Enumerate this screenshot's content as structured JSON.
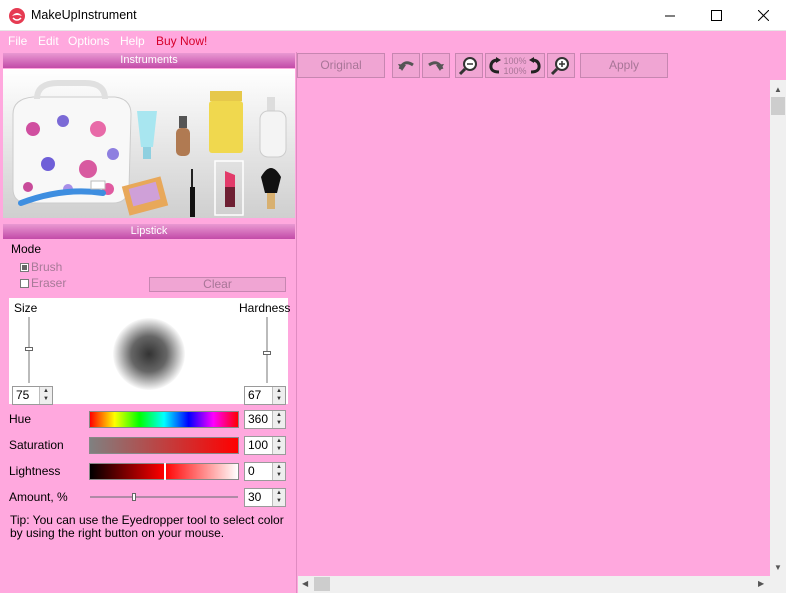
{
  "window": {
    "title": "MakeUpInstrument"
  },
  "menu": {
    "file": "File",
    "edit": "Edit",
    "options": "Options",
    "help": "Help",
    "buy": "Buy Now!"
  },
  "panels": {
    "instruments": "Instruments",
    "tool": "Lipstick"
  },
  "mode": {
    "label": "Mode",
    "brush": "Brush",
    "eraser": "Eraser",
    "clear": "Clear",
    "brush_checked": true
  },
  "brush": {
    "size_label": "Size",
    "hardness_label": "Hardness",
    "size": "75",
    "hardness": "67",
    "size_level": 0.52,
    "hardness_level": 0.45
  },
  "color": {
    "hue_label": "Hue",
    "hue": "360",
    "saturation_label": "Saturation",
    "saturation": "100",
    "lightness_label": "Lightness",
    "lightness": "0",
    "amount_label": "Amount, %",
    "amount": "30",
    "amount_level": 0.3
  },
  "tip": "Tip: You can use the Eyedropper tool to select color by using the right button on your mouse.",
  "toolbar": {
    "original": "Original",
    "apply": "Apply",
    "zoom_top": "100%",
    "zoom_bottom": "100%"
  },
  "icons": [
    "app-icon",
    "undo-icon",
    "redo-icon",
    "zoom-out-icon",
    "rotate-left-icon",
    "rotate-right-icon",
    "zoom-in-icon"
  ],
  "colors": {
    "background": "#ffa8de",
    "panel_header": "#c24ba8",
    "buy_now": "#d6002a"
  }
}
